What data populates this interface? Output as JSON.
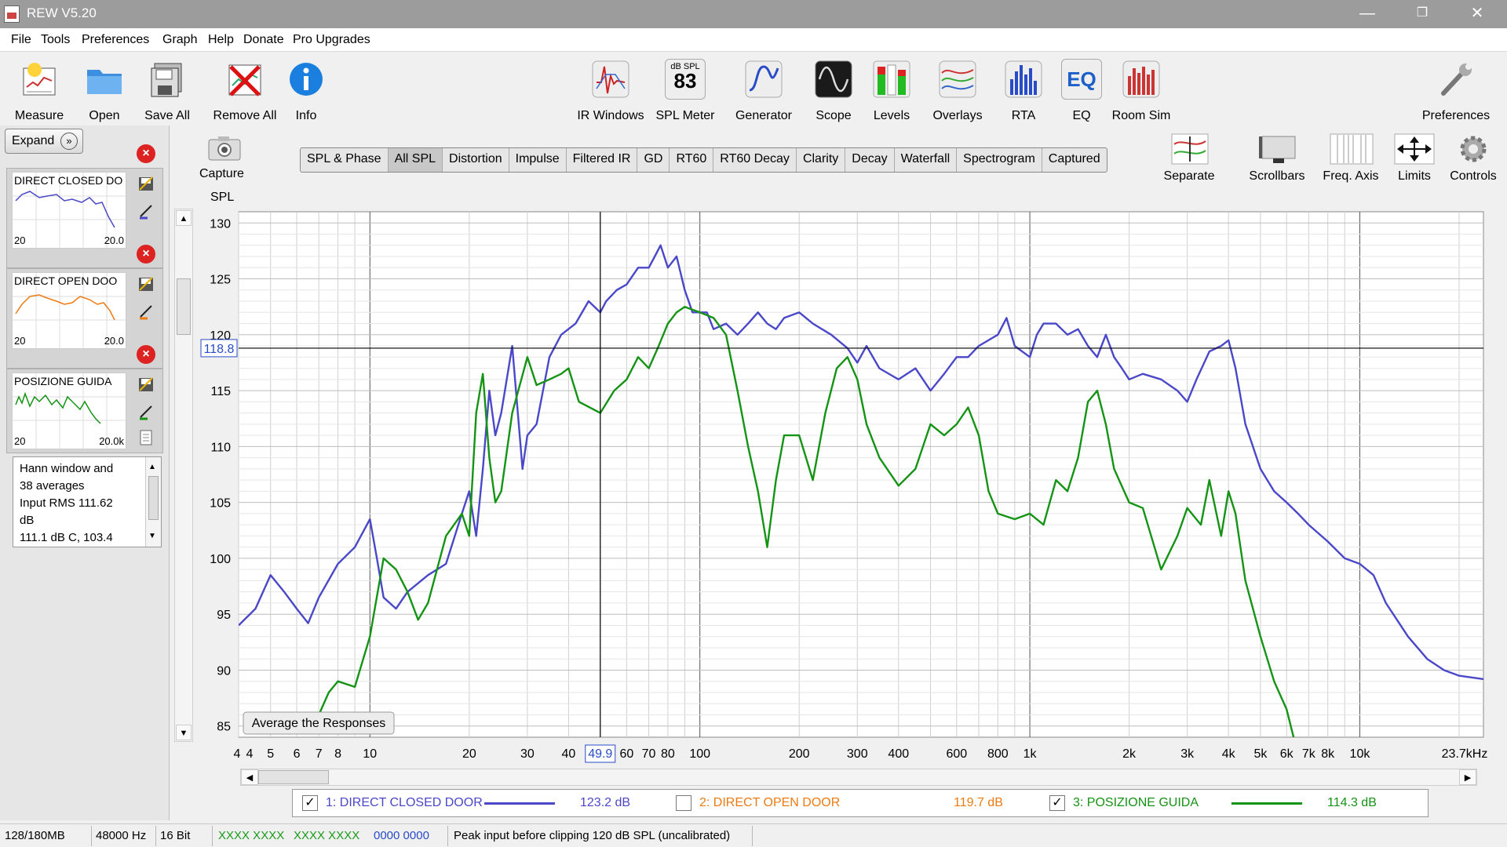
{
  "window": {
    "title": "REW V5.20",
    "minimize": "—",
    "restore": "❐",
    "close": "✕"
  },
  "menu": [
    "File",
    "Tools",
    "Preferences",
    "Graph",
    "Help",
    "Donate",
    "Pro Upgrades"
  ],
  "toolbar": {
    "left": [
      {
        "label": "Measure",
        "icon": "measure-icon"
      },
      {
        "label": "Open",
        "icon": "folder-icon"
      },
      {
        "label": "Save All",
        "icon": "save-all-icon"
      },
      {
        "label": "Remove All",
        "icon": "remove-all-icon"
      },
      {
        "label": "Info",
        "icon": "info-icon"
      }
    ],
    "center": [
      {
        "label": "IR Windows",
        "icon": "ir-windows-icon"
      },
      {
        "label": "SPL Meter",
        "icon": "spl-meter-icon",
        "icon_text_top": "dB SPL",
        "icon_text_main": "83"
      },
      {
        "label": "Generator",
        "icon": "generator-icon"
      },
      {
        "label": "Scope",
        "icon": "scope-icon"
      },
      {
        "label": "Levels",
        "icon": "levels-icon"
      },
      {
        "label": "Overlays",
        "icon": "overlays-icon"
      },
      {
        "label": "RTA",
        "icon": "rta-icon"
      },
      {
        "label": "EQ",
        "icon": "eq-icon",
        "icon_text_main": "EQ"
      },
      {
        "label": "Room Sim",
        "icon": "room-sim-icon"
      }
    ],
    "right": {
      "label": "Preferences",
      "icon": "wrench-icon"
    }
  },
  "graph_tools": [
    {
      "label": "Separate",
      "icon": "separate-icon"
    },
    {
      "label": "Scrollbars",
      "icon": "scrollbars-icon"
    },
    {
      "label": "Freq. Axis",
      "icon": "freq-axis-icon"
    },
    {
      "label": "Limits",
      "icon": "limits-icon"
    },
    {
      "label": "Controls",
      "icon": "gear-icon"
    }
  ],
  "capture": {
    "label": "Capture"
  },
  "expand": {
    "label": "Expand",
    "chevron": "»"
  },
  "tabs": [
    {
      "label": "SPL & Phase",
      "active": false
    },
    {
      "label": "All SPL",
      "active": true
    },
    {
      "label": "Distortion",
      "active": false
    },
    {
      "label": "Impulse",
      "active": false
    },
    {
      "label": "Filtered IR",
      "active": false
    },
    {
      "label": "GD",
      "active": false
    },
    {
      "label": "RT60",
      "active": false
    },
    {
      "label": "RT60 Decay",
      "active": false
    },
    {
      "label": "Clarity",
      "active": false
    },
    {
      "label": "Decay",
      "active": false
    },
    {
      "label": "Waterfall",
      "active": false
    },
    {
      "label": "Spectrogram",
      "active": false
    },
    {
      "label": "Captured",
      "active": false
    }
  ],
  "measurements": [
    {
      "title": "DIRECT CLOSED DO",
      "x_start": "20",
      "x_end": "20.0",
      "color": "#4a48c8"
    },
    {
      "title": "DIRECT OPEN DOO",
      "x_start": "20",
      "x_end": "20.0",
      "color": "#ee7b12"
    },
    {
      "title": "POSIZIONE GUIDA",
      "x_start": "20",
      "x_end": "20.0k",
      "color": "#149314"
    }
  ],
  "info_text": [
    "Hann window and",
    "38 averages",
    "Input RMS 111.62",
    "dB",
    "111.1 dB C, 103.4"
  ],
  "chart_data": {
    "type": "line",
    "ylabel": "SPL",
    "ylim": [
      84,
      131
    ],
    "y_ticks": [
      "130",
      "125",
      "120",
      "115",
      "110",
      "105",
      "100",
      "95",
      "90",
      "85"
    ],
    "x_scale": "log",
    "xlim": [
      4,
      23700
    ],
    "x_ticks": [
      "4",
      "4",
      "5",
      "6",
      "7",
      "8",
      "10",
      "20",
      "30",
      "40",
      "60",
      "70",
      "80",
      "100",
      "200",
      "300",
      "400",
      "600",
      "800",
      "1k",
      "2k",
      "3k",
      "4k",
      "5k",
      "6k",
      "7k",
      "8k",
      "10k",
      "23.7kHz"
    ],
    "cursor": {
      "x": 49.9,
      "y": 118.8,
      "x_label": "49.9",
      "y_label": "118.8"
    },
    "grid": true,
    "series": [
      {
        "name": "1: DIRECT CLOSED DOOR",
        "color": "#4a48c8",
        "points": [
          [
            4,
            94
          ],
          [
            4.5,
            95.5
          ],
          [
            5,
            98.5
          ],
          [
            5.5,
            97
          ],
          [
            6,
            95.5
          ],
          [
            6.5,
            94.2
          ],
          [
            7,
            96.5
          ],
          [
            8,
            99.5
          ],
          [
            9,
            101
          ],
          [
            10,
            103.5
          ],
          [
            10.5,
            100
          ],
          [
            11,
            96.5
          ],
          [
            12,
            95.5
          ],
          [
            13,
            97
          ],
          [
            15,
            98.5
          ],
          [
            17,
            99.5
          ],
          [
            19,
            104
          ],
          [
            20,
            106
          ],
          [
            21,
            102
          ],
          [
            22,
            108
          ],
          [
            23,
            115
          ],
          [
            24,
            111
          ],
          [
            25,
            113
          ],
          [
            27,
            119
          ],
          [
            29,
            108
          ],
          [
            30,
            111
          ],
          [
            32,
            112
          ],
          [
            35,
            118
          ],
          [
            38,
            120
          ],
          [
            42,
            121
          ],
          [
            46,
            123
          ],
          [
            49.9,
            122
          ],
          [
            52,
            123
          ],
          [
            56,
            124
          ],
          [
            60,
            124.5
          ],
          [
            65,
            126
          ],
          [
            70,
            126
          ],
          [
            73,
            127
          ],
          [
            76,
            128
          ],
          [
            80,
            126
          ],
          [
            85,
            127
          ],
          [
            90,
            124
          ],
          [
            95,
            122
          ],
          [
            100,
            122
          ],
          [
            105,
            122
          ],
          [
            110,
            120.5
          ],
          [
            120,
            121
          ],
          [
            130,
            120
          ],
          [
            140,
            121
          ],
          [
            150,
            122
          ],
          [
            160,
            121
          ],
          [
            170,
            120.5
          ],
          [
            180,
            121.5
          ],
          [
            200,
            122
          ],
          [
            220,
            121
          ],
          [
            250,
            120
          ],
          [
            280,
            118.8
          ],
          [
            300,
            117.5
          ],
          [
            320,
            119
          ],
          [
            350,
            117
          ],
          [
            400,
            116
          ],
          [
            450,
            117
          ],
          [
            500,
            115
          ],
          [
            550,
            116.5
          ],
          [
            600,
            118
          ],
          [
            650,
            118
          ],
          [
            700,
            119
          ],
          [
            800,
            120
          ],
          [
            850,
            121.5
          ],
          [
            900,
            119
          ],
          [
            1000,
            118
          ],
          [
            1050,
            120
          ],
          [
            1100,
            121
          ],
          [
            1200,
            121
          ],
          [
            1300,
            120
          ],
          [
            1400,
            120.5
          ],
          [
            1500,
            119
          ],
          [
            1600,
            118
          ],
          [
            1700,
            120
          ],
          [
            1800,
            118
          ],
          [
            1900,
            117
          ],
          [
            2000,
            116
          ],
          [
            2200,
            116.5
          ],
          [
            2500,
            116
          ],
          [
            2800,
            115
          ],
          [
            3000,
            114
          ],
          [
            3200,
            116
          ],
          [
            3500,
            118.5
          ],
          [
            3800,
            119
          ],
          [
            4000,
            119.5
          ],
          [
            4200,
            117
          ],
          [
            4500,
            112
          ],
          [
            5000,
            108
          ],
          [
            5500,
            106
          ],
          [
            6000,
            105
          ],
          [
            6500,
            104
          ],
          [
            7000,
            103
          ],
          [
            8000,
            101.5
          ],
          [
            9000,
            100
          ],
          [
            10000,
            99.5
          ],
          [
            11000,
            98.5
          ],
          [
            12000,
            96
          ],
          [
            14000,
            93
          ],
          [
            16000,
            91
          ],
          [
            18000,
            90
          ],
          [
            20000,
            89.5
          ],
          [
            23700,
            89.2
          ]
        ]
      },
      {
        "name": "2: DIRECT OPEN DOOR",
        "color": "#ee7b12",
        "points": []
      },
      {
        "name": "3: POSIZIONE GUIDA",
        "color": "#149314",
        "points": [
          [
            7,
            86
          ],
          [
            7.5,
            88
          ],
          [
            8,
            89
          ],
          [
            9,
            88.5
          ],
          [
            10,
            93
          ],
          [
            11,
            100
          ],
          [
            12,
            99
          ],
          [
            13,
            97
          ],
          [
            14,
            94.5
          ],
          [
            15,
            96
          ],
          [
            17,
            102
          ],
          [
            19,
            104
          ],
          [
            20,
            102
          ],
          [
            21,
            113
          ],
          [
            22,
            116.5
          ],
          [
            23,
            109
          ],
          [
            24,
            105
          ],
          [
            25,
            106
          ],
          [
            27,
            113
          ],
          [
            30,
            118
          ],
          [
            32,
            115.5
          ],
          [
            35,
            116
          ],
          [
            38,
            116.5
          ],
          [
            40,
            117
          ],
          [
            43,
            114
          ],
          [
            49.9,
            113
          ],
          [
            55,
            115
          ],
          [
            60,
            116
          ],
          [
            65,
            118
          ],
          [
            70,
            117
          ],
          [
            75,
            119
          ],
          [
            80,
            121
          ],
          [
            85,
            122
          ],
          [
            90,
            122.5
          ],
          [
            100,
            122
          ],
          [
            110,
            121.5
          ],
          [
            120,
            120
          ],
          [
            130,
            115
          ],
          [
            140,
            110
          ],
          [
            150,
            106
          ],
          [
            160,
            101
          ],
          [
            170,
            107
          ],
          [
            180,
            111
          ],
          [
            200,
            111
          ],
          [
            220,
            107
          ],
          [
            240,
            113
          ],
          [
            260,
            117
          ],
          [
            280,
            118
          ],
          [
            300,
            116
          ],
          [
            320,
            112
          ],
          [
            350,
            109
          ],
          [
            400,
            106.5
          ],
          [
            450,
            108
          ],
          [
            500,
            112
          ],
          [
            550,
            111
          ],
          [
            600,
            112
          ],
          [
            650,
            113.5
          ],
          [
            700,
            111
          ],
          [
            750,
            106
          ],
          [
            800,
            104
          ],
          [
            900,
            103.5
          ],
          [
            1000,
            104
          ],
          [
            1100,
            103
          ],
          [
            1200,
            107
          ],
          [
            1300,
            106
          ],
          [
            1400,
            109
          ],
          [
            1500,
            114
          ],
          [
            1600,
            115
          ],
          [
            1700,
            112
          ],
          [
            1800,
            108
          ],
          [
            2000,
            105
          ],
          [
            2200,
            104.5
          ],
          [
            2500,
            99
          ],
          [
            2800,
            102
          ],
          [
            3000,
            104.5
          ],
          [
            3300,
            103
          ],
          [
            3500,
            107
          ],
          [
            3800,
            102
          ],
          [
            4000,
            106
          ],
          [
            4200,
            104
          ],
          [
            4500,
            98
          ],
          [
            5000,
            93
          ],
          [
            5500,
            89
          ],
          [
            6000,
            86.5
          ],
          [
            6300,
            84
          ]
        ]
      }
    ],
    "legend": [
      {
        "name": "1: DIRECT CLOSED DOOR",
        "value": "123.2 dB",
        "checked": true,
        "color": "#4a48c8"
      },
      {
        "name": "2: DIRECT OPEN DOOR",
        "value": "119.7 dB",
        "checked": false,
        "color": "#ee7b12"
      },
      {
        "name": "3: POSIZIONE GUIDA",
        "value": "114.3 dB",
        "checked": true,
        "color": "#149314"
      }
    ],
    "overlay_button": "Average the Responses"
  },
  "status": {
    "memory": "128/180MB",
    "sample_rate": "48000 Hz",
    "bit_depth": "16 Bit",
    "meter_green_1": "XXXX XXXX",
    "meter_green_2": "XXXX XXXX",
    "meter_blue": "0000 0000",
    "message": "Peak input before clipping 120 dB SPL (uncalibrated)"
  }
}
